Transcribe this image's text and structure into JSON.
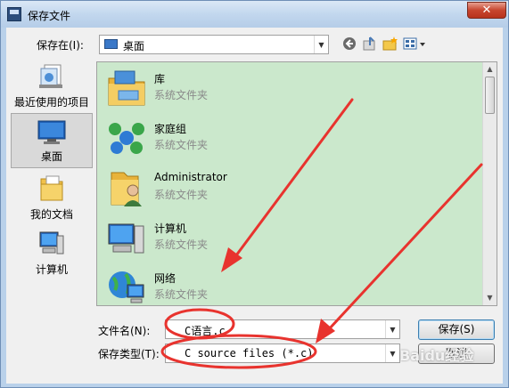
{
  "window": {
    "title": "保存文件",
    "close_label": "✕"
  },
  "toolbar": {
    "save_in_label": "保存在(I):",
    "save_in_value": "桌面",
    "icons": [
      "back-icon",
      "up-folder-icon",
      "new-folder-icon",
      "view-menu-icon"
    ]
  },
  "places": [
    {
      "label": "最近使用的项目",
      "icon": "recent-items-icon",
      "selected": false
    },
    {
      "label": "桌面",
      "icon": "desktop-icon",
      "selected": true
    },
    {
      "label": "我的文档",
      "icon": "documents-icon",
      "selected": false
    },
    {
      "label": "计算机",
      "icon": "computer-icon",
      "selected": false
    }
  ],
  "files": [
    {
      "name": "库",
      "type": "系统文件夹",
      "icon": "libraries-icon"
    },
    {
      "name": "家庭组",
      "type": "系统文件夹",
      "icon": "homegroup-icon"
    },
    {
      "name": "Administrator",
      "type": "系统文件夹",
      "icon": "user-folder-icon"
    },
    {
      "name": "计算机",
      "type": "系统文件夹",
      "icon": "computer-icon"
    },
    {
      "name": "网络",
      "type": "系统文件夹",
      "icon": "network-icon"
    }
  ],
  "form": {
    "filename_label": "文件名(N):",
    "filename_value": "C语言.c",
    "filetype_label": "保存类型(T):",
    "filetype_value": "C source files (*.c)",
    "save_button": "保存(S)",
    "cancel_button": "取消"
  },
  "watermark": "Baidu经验",
  "colors": {
    "list_background": "#cbe8cc",
    "annotation_red": "#e8332e"
  }
}
